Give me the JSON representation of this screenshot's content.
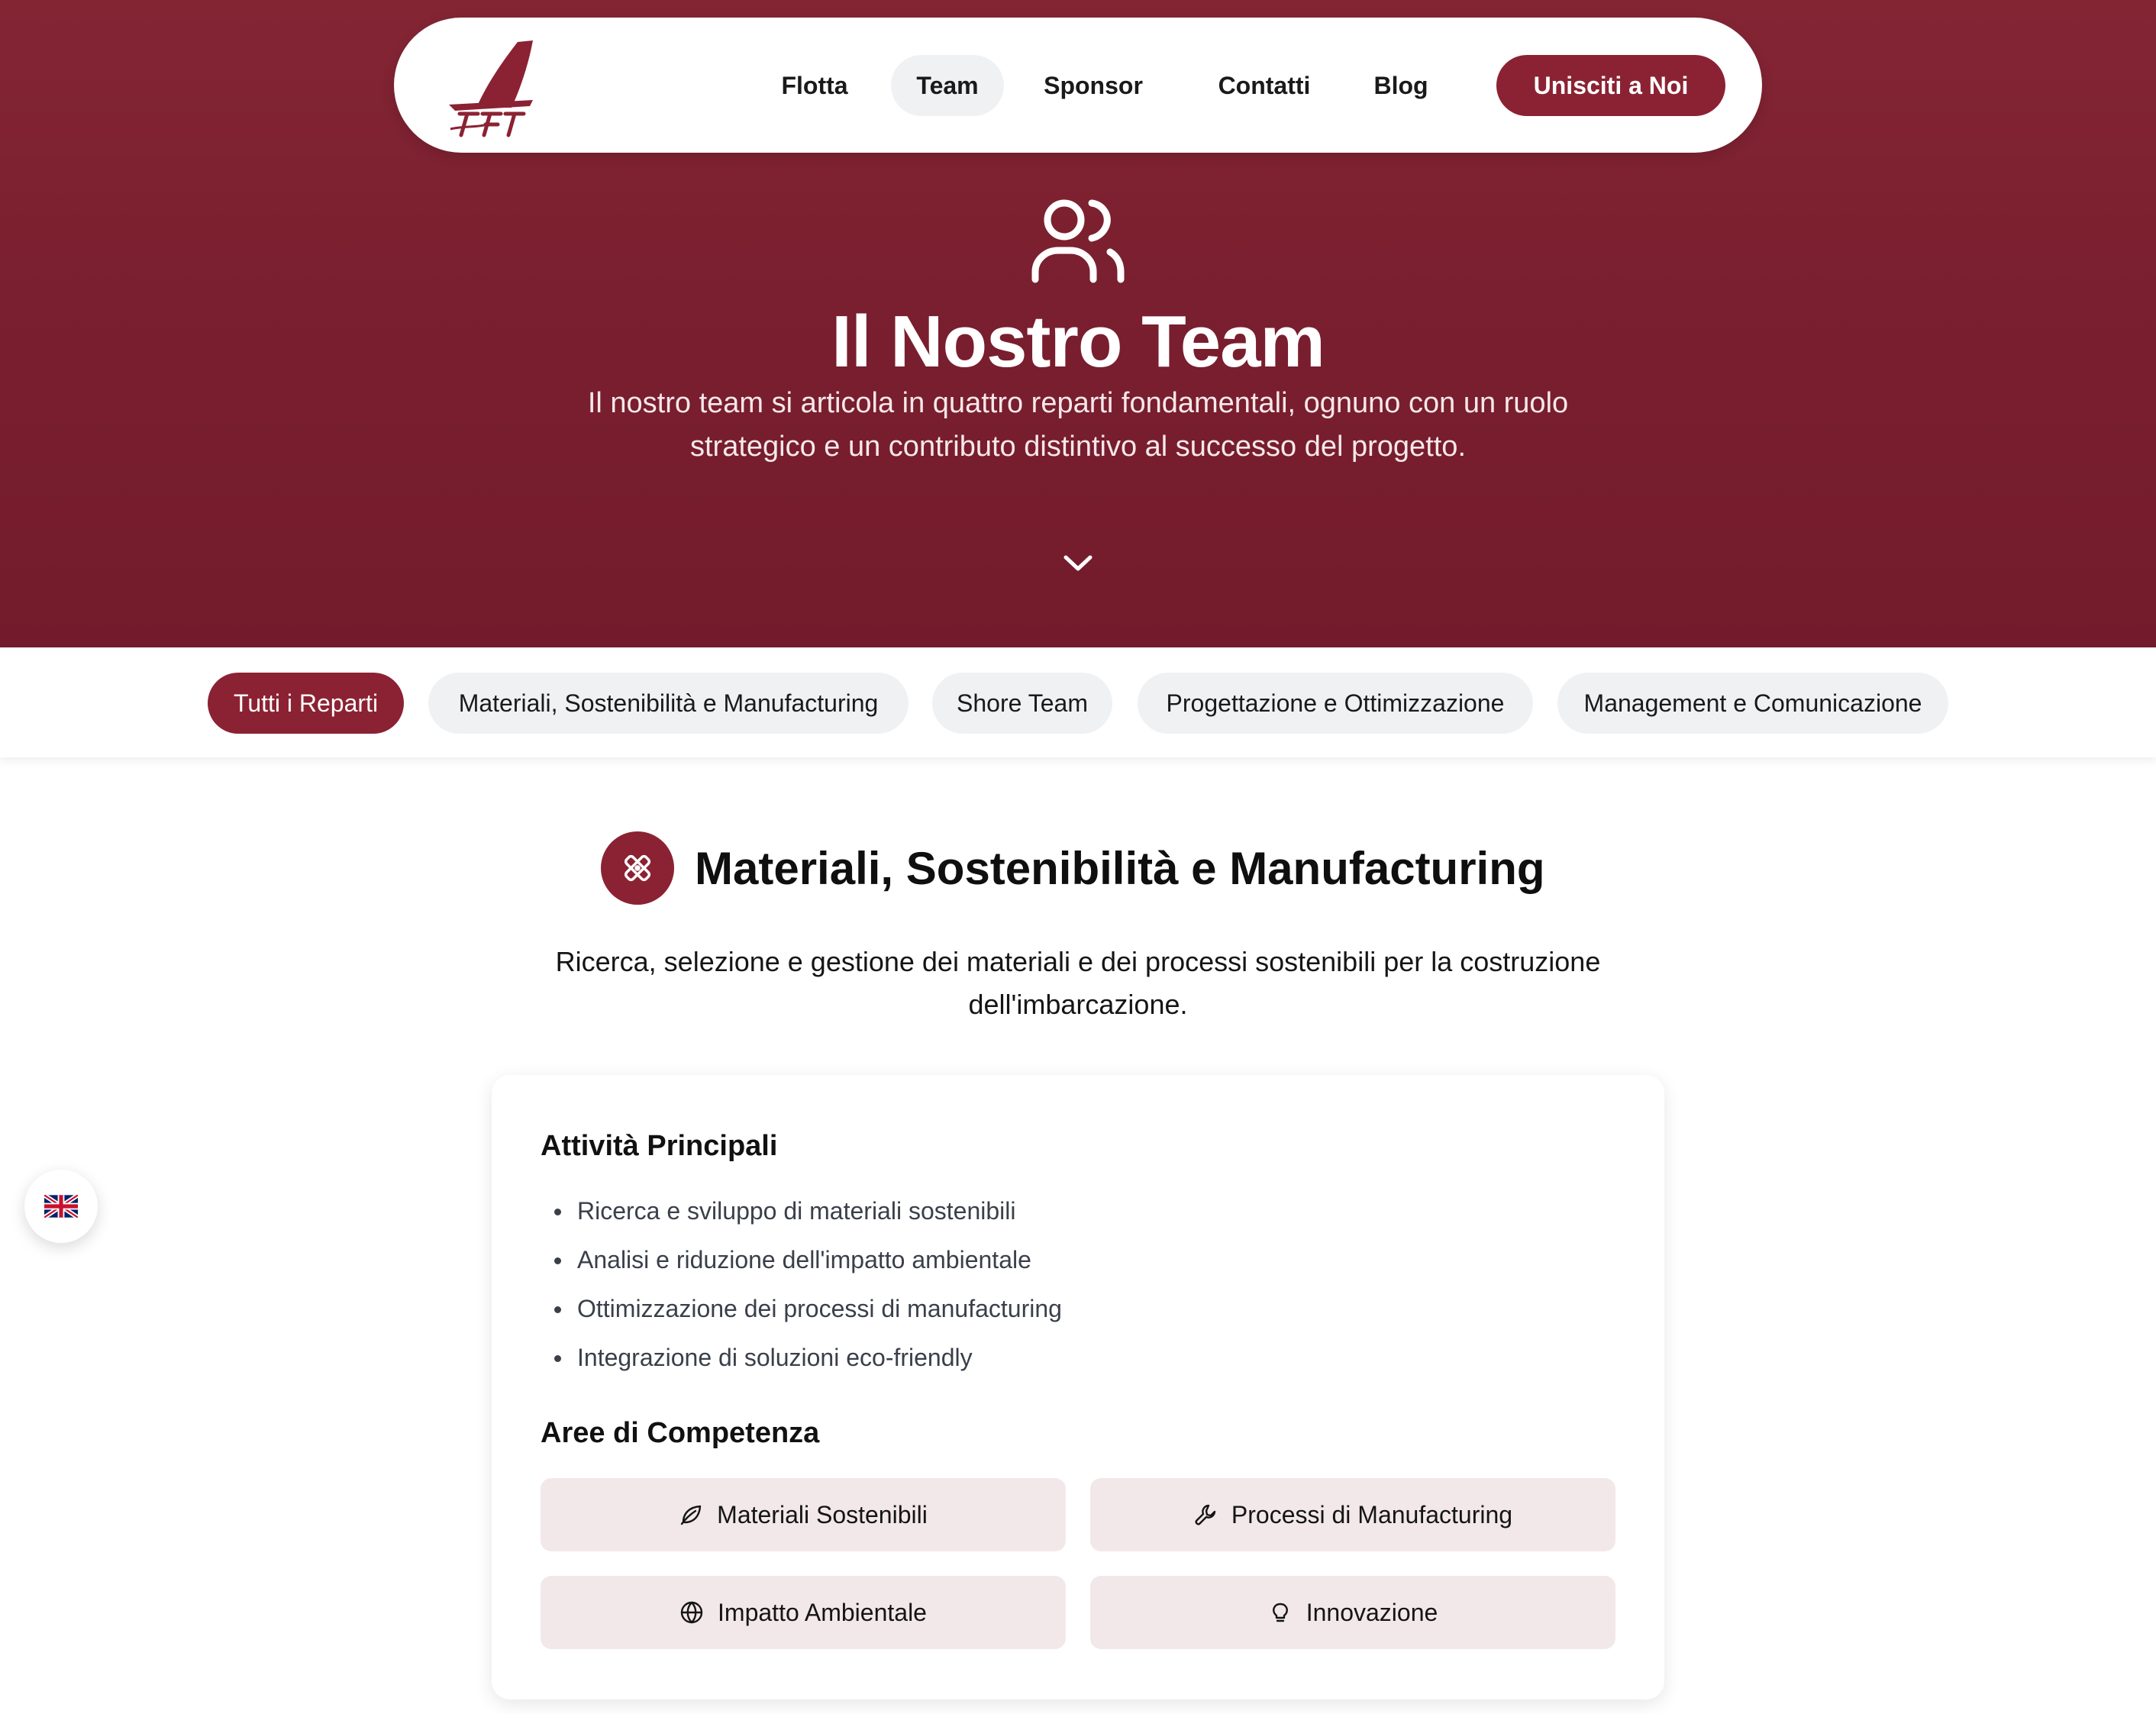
{
  "nav": {
    "logo_name": "sft-sailboat-logo",
    "items": [
      {
        "label": "Flotta"
      },
      {
        "label": "Team",
        "active": true
      },
      {
        "label": "Sponsor"
      },
      {
        "label": "Contatti"
      },
      {
        "label": "Blog"
      }
    ],
    "cta_label": "Unisciti a Noi"
  },
  "hero": {
    "icon": "users-icon",
    "title": "Il Nostro Team",
    "subtitle": "Il nostro team si articola in quattro reparti fondamentali, ognuno con un ruolo strategico e un contributo distintivo al successo del progetto.",
    "scroll_icon": "chevron-down-icon"
  },
  "filters": [
    {
      "label": "Tutti i Reparti",
      "active": true
    },
    {
      "label": "Materiali, Sostenibilità e Manufacturing"
    },
    {
      "label": "Shore Team"
    },
    {
      "label": "Progettazione e Ottimizzazione"
    },
    {
      "label": "Management e Comunicazione"
    }
  ],
  "section": {
    "icon": "tools-icon",
    "title": "Materiali, Sostenibilità e Manufacturing",
    "description": "Ricerca, selezione e gestione dei materiali e dei processi sostenibili per la costruzione dell'imbarcazione.",
    "activities_heading": "Attività Principali",
    "activities": [
      "Ricerca e sviluppo di materiali sostenibili",
      "Analisi e riduzione dell'impatto ambientale",
      "Ottimizzazione dei processi di manufacturing",
      "Integrazione di soluzioni eco-friendly"
    ],
    "competence_heading": "Aree di Competenza",
    "competences": [
      {
        "label": "Materiali Sostenibili",
        "icon": "leaf-icon"
      },
      {
        "label": "Processi di Manufacturing",
        "icon": "wrench-icon"
      },
      {
        "label": "Impatto Ambientale",
        "icon": "globe-icon"
      },
      {
        "label": "Innovazione",
        "icon": "lightbulb-icon"
      }
    ]
  },
  "language": {
    "icon": "uk-flag-icon"
  },
  "colors": {
    "brand": "#8b2233",
    "hero_bg": "#7a1f2f",
    "chip_bg": "#f0f1f3",
    "competence_bg": "#f2e8ea"
  }
}
